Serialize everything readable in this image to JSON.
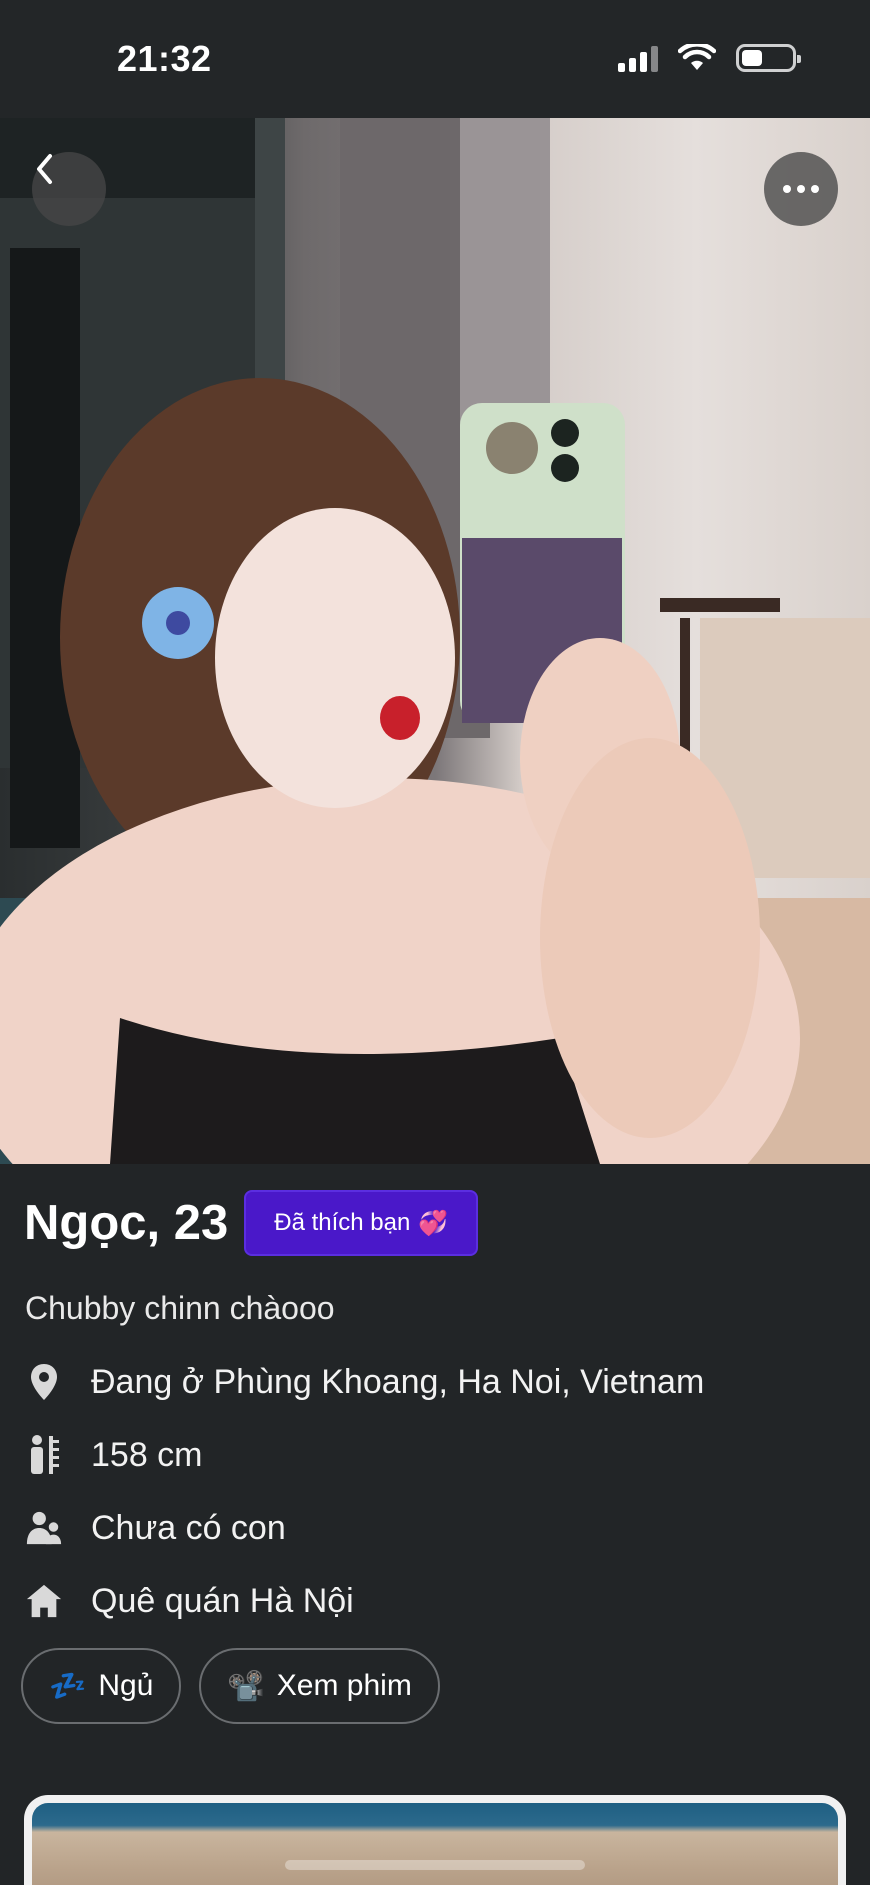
{
  "status_bar": {
    "time": "21:32"
  },
  "profile": {
    "name_age": "Ngọc, 23",
    "liked_badge": "Đã thích bạn",
    "liked_emoji": "💞",
    "bio": "Chubby chinn chàooo",
    "location": "Đang ở Phùng Khoang, Ha Noi, Vietnam",
    "height": "158 cm",
    "children": "Chưa có con",
    "hometown": "Quê quán Hà Nội",
    "interests": [
      {
        "emoji": "💤",
        "label": "Ngủ"
      },
      {
        "emoji": "📽️",
        "label": "Xem phim"
      }
    ]
  },
  "colors": {
    "background": "#222527",
    "badge": "#4a18c9"
  }
}
